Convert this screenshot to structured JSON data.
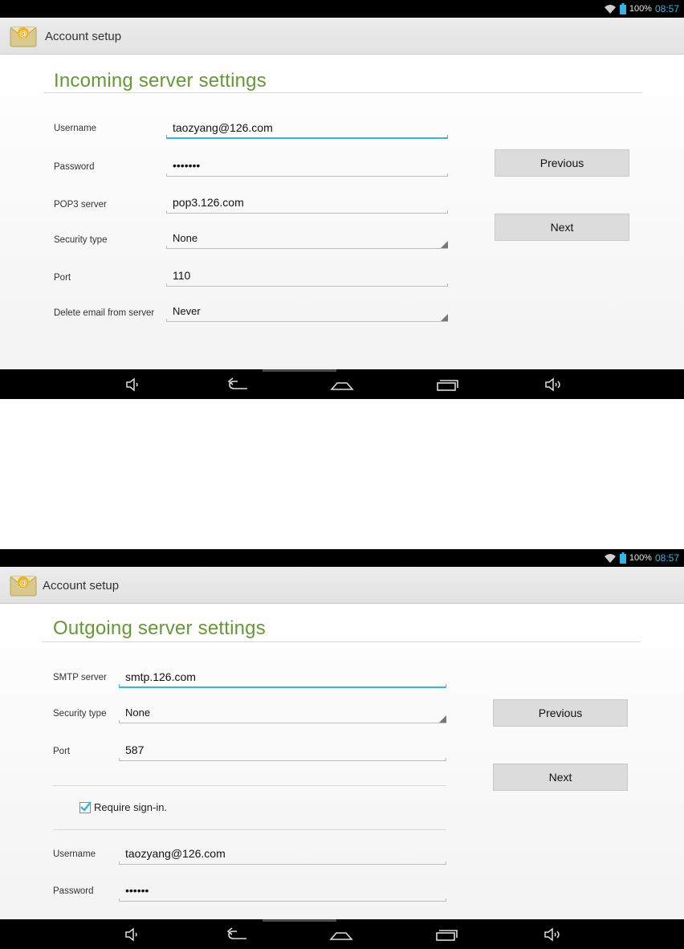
{
  "status_bar": {
    "battery": "100%",
    "time": "08:57",
    "icons": [
      "wifi-icon",
      "battery-icon"
    ]
  },
  "action_bar": {
    "title": "Account setup",
    "icon": "email-app-icon"
  },
  "incoming": {
    "title": "Incoming server settings",
    "fields": {
      "username": {
        "label": "Username",
        "value": "taozyang@126.com"
      },
      "password": {
        "label": "Password",
        "value": "•••••••"
      },
      "server": {
        "label": "POP3 server",
        "value": "pop3.126.com"
      },
      "security": {
        "label": "Security type",
        "value": "None"
      },
      "port": {
        "label": "Port",
        "value": "110"
      },
      "delete": {
        "label": "Delete email from server",
        "value": "Never"
      }
    },
    "previous_label": "Previous",
    "next_label": "Next"
  },
  "outgoing": {
    "title": "Outgoing server settings",
    "fields": {
      "server": {
        "label": "SMTP server",
        "value": "smtp.126.com"
      },
      "security": {
        "label": "Security type",
        "value": "None"
      },
      "port": {
        "label": "Port",
        "value": "587"
      },
      "username": {
        "label": "Username",
        "value": "taozyang@126.com"
      },
      "password": {
        "label": "Password",
        "value": "••••••"
      }
    },
    "require_signin": {
      "label": "Require sign-in.",
      "checked": true
    },
    "previous_label": "Previous",
    "next_label": "Next"
  },
  "nav_bar": {
    "icons": [
      "volume-down-icon",
      "back-icon",
      "home-icon",
      "recent-apps-icon",
      "volume-up-icon"
    ]
  },
  "colors": {
    "accent_blue": "#33b5e5",
    "title_green": "#669933",
    "status_bar": "#000000"
  }
}
